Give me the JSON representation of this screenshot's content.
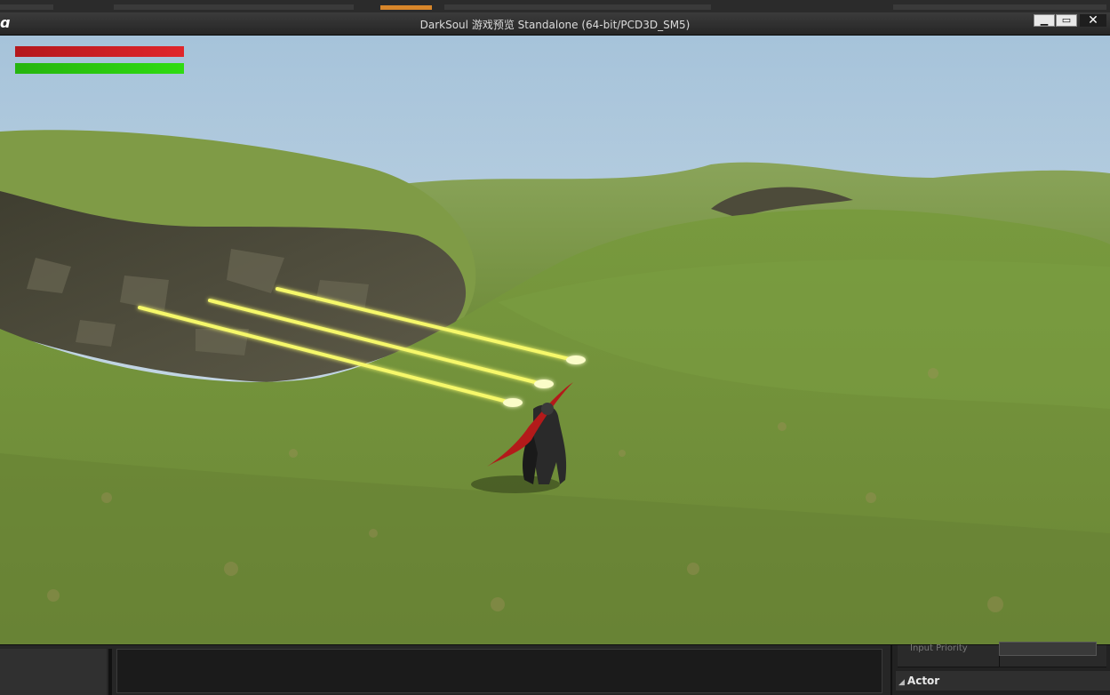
{
  "window": {
    "title": "DarkSoul 游戏预览 Standalone (64-bit/PCD3D_SM5)",
    "logo_icon": "unreal-logo-icon",
    "minimize_glyph": "▁",
    "maximize_glyph": "▭",
    "close_glyph": "✕"
  },
  "hud": {
    "health_bar": {
      "color": "#e0262b",
      "level": 1.0
    },
    "stamina_bar": {
      "color": "#2fdc12",
      "level": 1.0
    }
  },
  "scene": {
    "sky_color": "#b9cfe0",
    "grass_color": "#6e8f34",
    "beam_color": "#f3f65a",
    "beam_count": 3
  },
  "editor_bottom": {
    "faded_label": "Input Priority",
    "section_title": "Actor"
  }
}
